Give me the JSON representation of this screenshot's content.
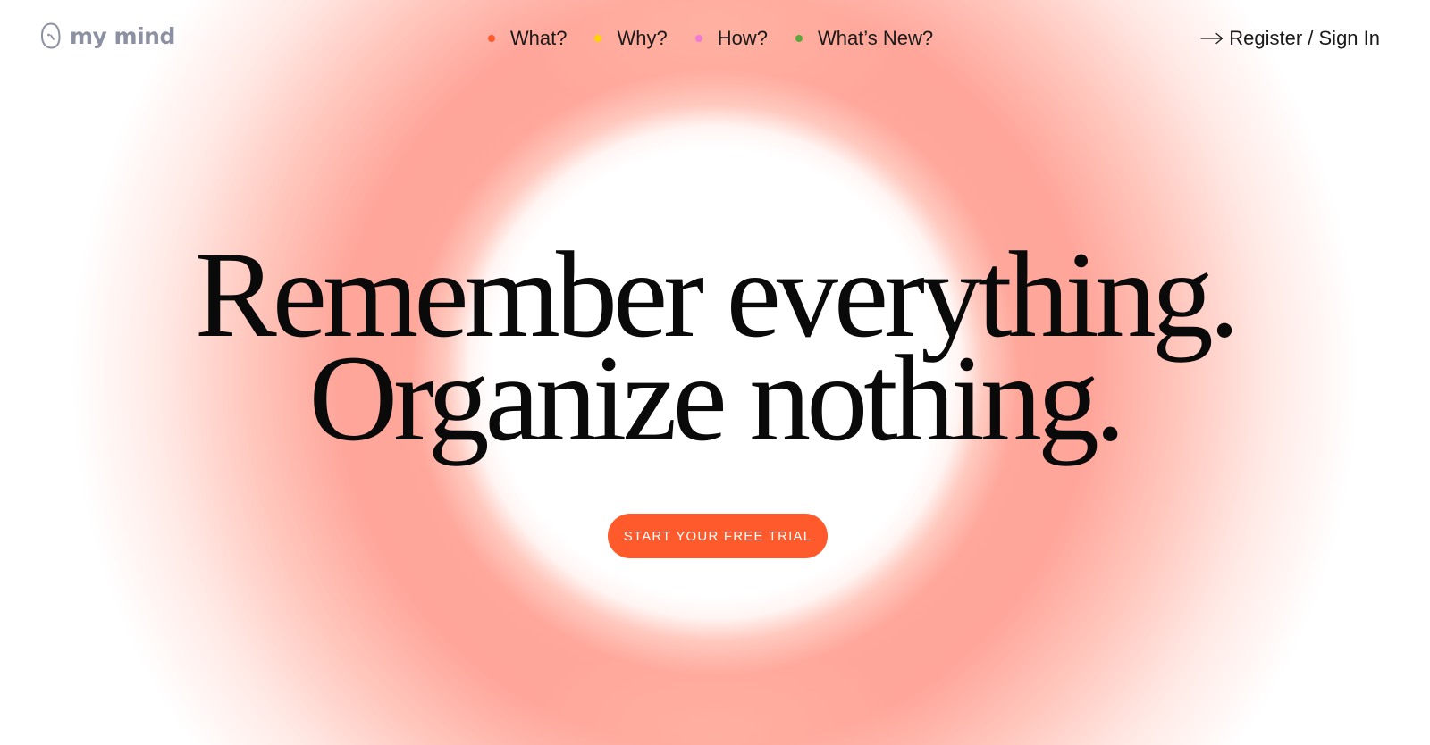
{
  "brand": {
    "name": "my mind",
    "color": "#8b90a3",
    "icon": "mind-logo-icon"
  },
  "nav": {
    "items": [
      {
        "label": "What?",
        "dot_color": "#ff5a2c"
      },
      {
        "label": "Why?",
        "dot_color": "#ffd400"
      },
      {
        "label": "How?",
        "dot_color": "#f07ad6"
      },
      {
        "label": "What’s New?",
        "dot_color": "#5aa83a"
      }
    ]
  },
  "auth": {
    "label": "Register / Sign In",
    "icon": "arrow-right-icon"
  },
  "hero": {
    "line1": "Remember everything.",
    "line2": "Organize nothing.",
    "cta_label": "START YOUR FREE TRIAL",
    "accent": "#ff5a2c"
  }
}
